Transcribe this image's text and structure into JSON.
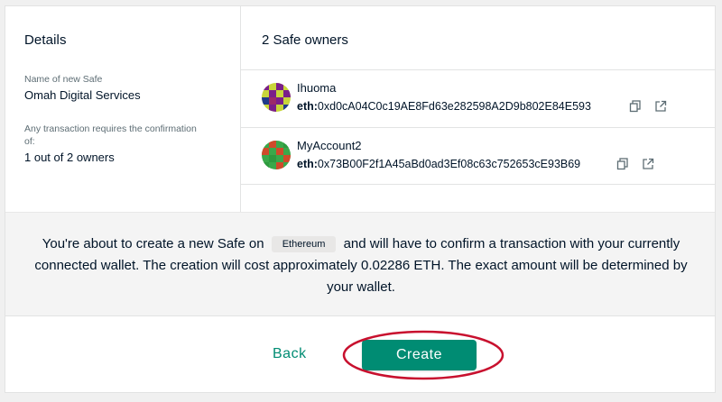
{
  "details": {
    "title": "Details",
    "name_label": "Name of new Safe",
    "name_value": "Omah Digital Services",
    "threshold_label": "Any transaction requires the confirmation of:",
    "threshold_value": "1 out of 2 owners"
  },
  "owners": {
    "title": "2 Safe owners",
    "items": [
      {
        "name": "Ihuoma",
        "prefix": "eth:",
        "address": "0xd0cA04C0c19AE8Fd63e282598A2D9b802E84E593",
        "avatar_colors": [
          "#7a1f8a",
          "#c8d63a",
          "#1f3a8a"
        ]
      },
      {
        "name": "MyAccount2",
        "prefix": "eth:",
        "address": "0x73B00F2f1A45aBd0ad3Ef08c63c752653cE93B69",
        "avatar_colors": [
          "#2e9a3f",
          "#d04a2a",
          "#3aa84a"
        ]
      }
    ]
  },
  "info": {
    "text_before": "You're about to create a new Safe on",
    "network": "Ethereum",
    "text_after": "and will have to confirm a transaction with your currently connected wallet. The creation will cost approximately 0.02286 ETH. The exact amount will be determined by your wallet."
  },
  "footer": {
    "back_label": "Back",
    "create_label": "Create"
  },
  "colors": {
    "accent": "#008c73",
    "highlight": "#c8102e",
    "band": "#f4f4f4"
  },
  "icons": {
    "copy": "copy-icon",
    "external": "external-link-icon"
  }
}
